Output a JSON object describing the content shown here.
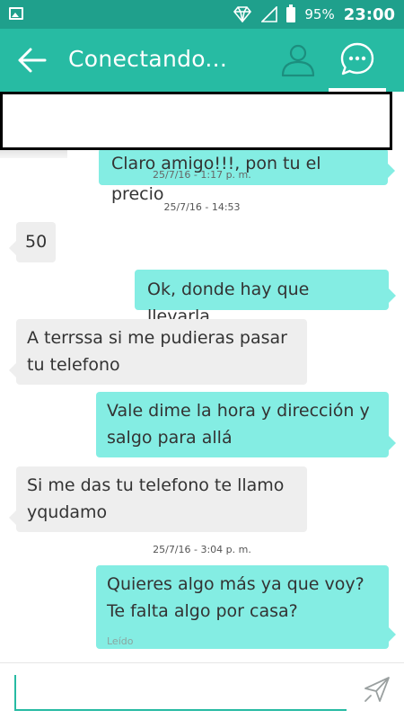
{
  "status_bar": {
    "battery": "95%",
    "time": "23:00"
  },
  "app_bar": {
    "title": "Conectando..."
  },
  "messages": {
    "partial_top": {
      "text": "Claro amigo!!!, pon tu el precio",
      "time": "25/7/16 - 1:17 p. m."
    },
    "timestamp_1": "25/7/16 - 14:53",
    "m1": "50",
    "m2": "Ok, donde hay que llevarla",
    "m3": [
      "A terrssa si me pudieras pasar",
      "tu telefono"
    ],
    "m4": [
      "Vale dime la hora y dirección y",
      "salgo para allá"
    ],
    "m5": [
      "Si me das tu telefono te llamo",
      "yqudamo"
    ],
    "timestamp_2": "25/7/16 - 3:04 p. m.",
    "m6": [
      "Quieres algo más ya que voy?",
      "Te falta algo por casa?"
    ],
    "read_status": "Leído"
  },
  "input": {
    "value": ""
  },
  "colors": {
    "status_bar": "#1fa08c",
    "app_bar": "#27bba3",
    "outgoing_bubble": "#84ede3",
    "incoming_bubble": "#eeeeee"
  }
}
